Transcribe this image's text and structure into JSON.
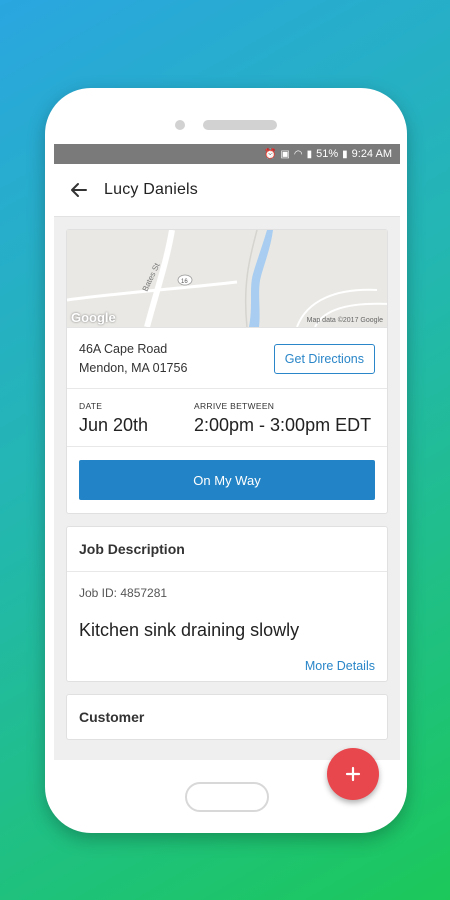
{
  "status_bar": {
    "battery": "51%",
    "time": "9:24 AM"
  },
  "appbar": {
    "title": "Lucy Daniels",
    "back_icon": "arrow-left-icon"
  },
  "map": {
    "provider_logo": "Google",
    "copyright": "Map data ©2017 Google",
    "road_label": "Bates St",
    "route_shield": "16"
  },
  "appointment": {
    "address_line1": "46A Cape Road",
    "address_line2": "Mendon, MA 01756",
    "directions_label": "Get Directions",
    "date_label": "DATE",
    "date_value": "Jun 20th",
    "arrive_label": "ARRIVE BETWEEN",
    "arrive_value": "2:00pm - 3:00pm EDT",
    "on_my_way_label": "On My Way"
  },
  "job": {
    "heading": "Job Description",
    "job_id": "Job ID: 4857281",
    "title": "Kitchen sink draining slowly",
    "more_label": "More Details"
  },
  "customer": {
    "heading": "Customer"
  },
  "fab": {
    "icon": "plus-icon"
  },
  "colors": {
    "primary": "#2284c6",
    "fab": "#e8474d",
    "link": "#2a86c8"
  }
}
